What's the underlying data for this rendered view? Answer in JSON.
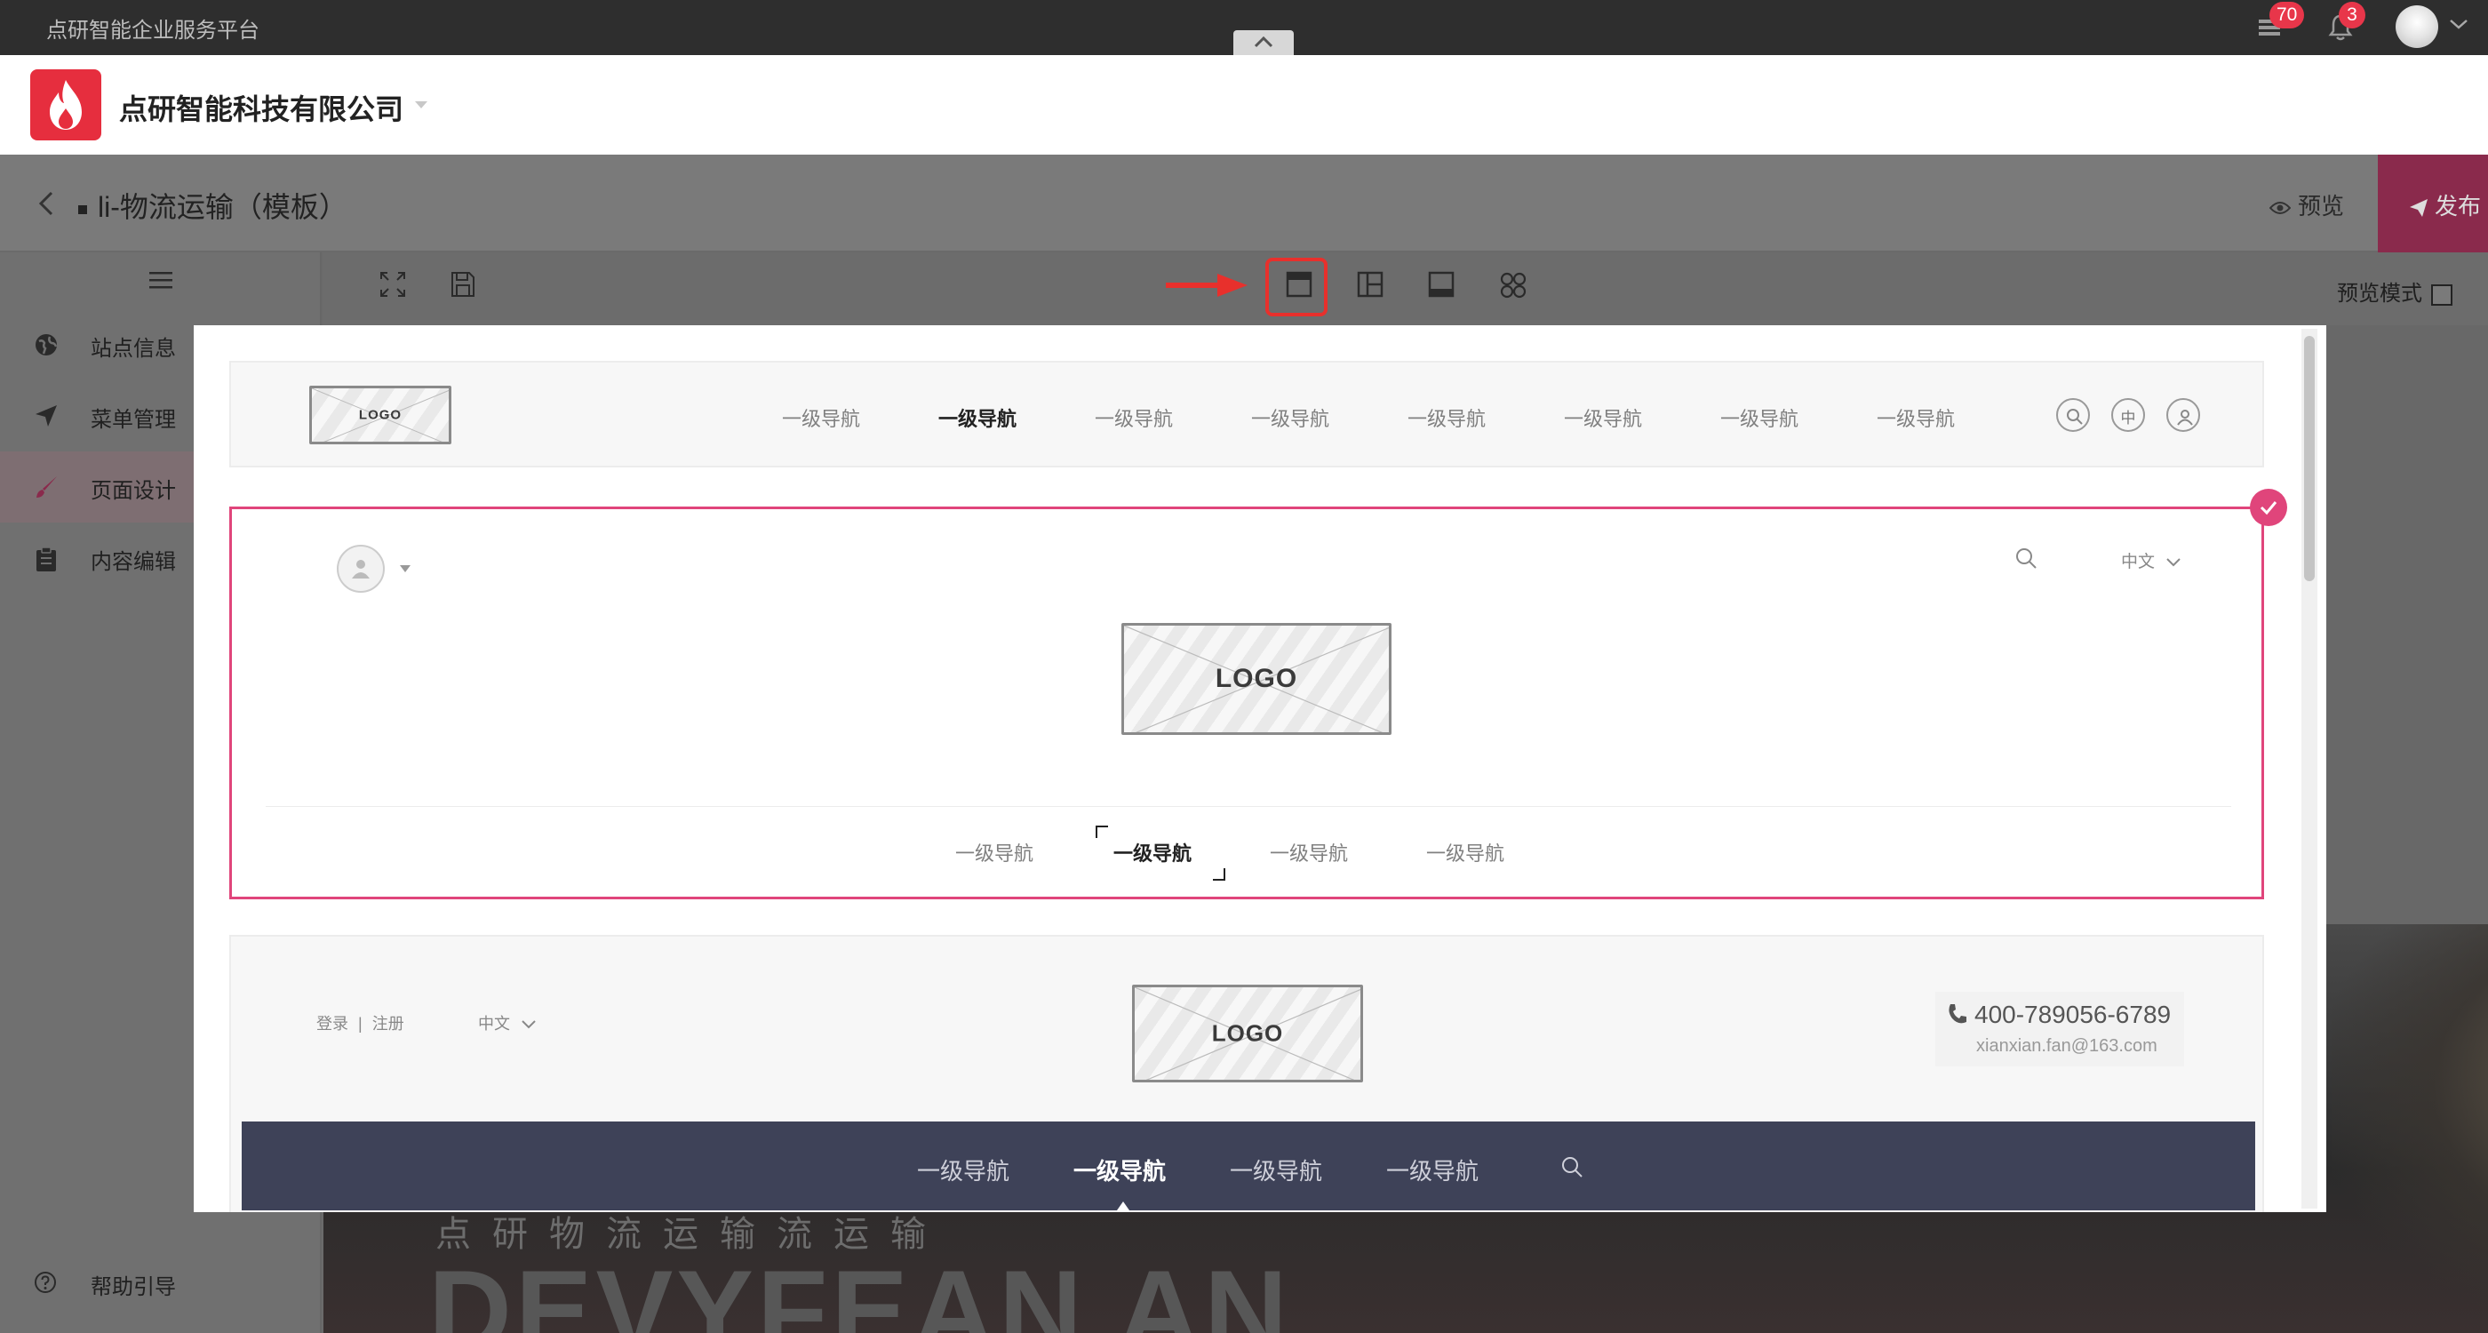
{
  "platform": {
    "title": "点研智能企业服务平台",
    "list_badge": "70",
    "bell_badge": "3"
  },
  "company": {
    "name": "点研智能科技有限公司"
  },
  "editor": {
    "page_title": "li-物流运输（模板）",
    "preview_label": "预览",
    "publish_label": "发布",
    "preview_mode_label": "预览模式"
  },
  "sidebar": {
    "items": [
      {
        "label": "站点信息",
        "icon": "globe-icon"
      },
      {
        "label": "菜单管理",
        "icon": "navigation-icon"
      },
      {
        "label": "页面设计",
        "icon": "brush-icon"
      },
      {
        "label": "内容编辑",
        "icon": "clipboard-icon"
      }
    ],
    "help_label": "帮助引导"
  },
  "canvas": {
    "sub_text": "点研物流运输流运输",
    "big_text": "DEVYFEAN AN"
  },
  "templates": {
    "logo_text": "LOGO",
    "nav_label": "一级导航",
    "tpl1": {
      "nav": [
        "一级导航",
        "一级导航",
        "一级导航",
        "一级导航",
        "一级导航",
        "一级导航",
        "一级导航",
        "一级导航"
      ],
      "lang_icon_text": "中"
    },
    "tpl2": {
      "lang": "中文",
      "nav": [
        "一级导航",
        "一级导航",
        "一级导航",
        "一级导航"
      ]
    },
    "tpl3": {
      "login": "登录",
      "register": "注册",
      "separator": "|",
      "lang": "中文",
      "phone": "400-789056-6789",
      "email": "xianxian.fan@163.com",
      "nav": [
        "一级导航",
        "一级导航",
        "一级导航",
        "一级导航"
      ]
    }
  },
  "colors": {
    "accent": "#e0457b",
    "brand_red": "#e62e3e",
    "highlight": "#e8302c",
    "nav_dark": "#3e4258"
  }
}
